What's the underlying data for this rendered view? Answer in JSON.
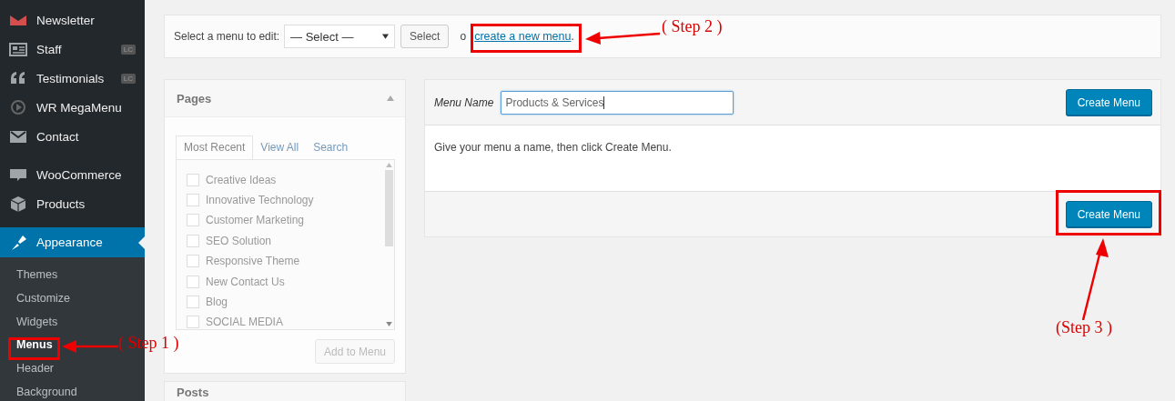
{
  "sidebar": {
    "items": [
      {
        "label": "Newsletter",
        "selected": false
      },
      {
        "label": "Staff",
        "badge": "LC",
        "selected": false
      },
      {
        "label": "Testimonials",
        "badge": "LC",
        "selected": false
      },
      {
        "label": "WR MegaMenu",
        "selected": false
      },
      {
        "label": "Contact",
        "selected": false
      },
      {
        "label": "WooCommerce",
        "selected": false
      },
      {
        "label": "Products",
        "selected": false
      },
      {
        "label": "Appearance",
        "selected": true,
        "children": [
          {
            "label": "Themes",
            "selected": false
          },
          {
            "label": "Customize",
            "selected": false
          },
          {
            "label": "Widgets",
            "selected": false
          },
          {
            "label": "Menus",
            "selected": true
          },
          {
            "label": "Header",
            "selected": false
          },
          {
            "label": "Background",
            "selected": false
          }
        ]
      }
    ]
  },
  "menu_selector": {
    "label": "Select a menu to edit:",
    "value": "— Select —",
    "button": "Select",
    "or_text": "o",
    "link": "create a new menu",
    "link_end": "."
  },
  "pages_panel": {
    "title": "Pages",
    "expanded": true,
    "tabs": [
      {
        "label": "Most Recent",
        "selected": true
      },
      {
        "label": "View All",
        "selected": false
      },
      {
        "label": "Search",
        "selected": false
      }
    ],
    "items": [
      {
        "label": "Creative Ideas",
        "checked": false
      },
      {
        "label": "Innovative Technology",
        "checked": false
      },
      {
        "label": "Customer Marketing",
        "checked": false
      },
      {
        "label": "SEO Solution",
        "checked": false
      },
      {
        "label": "Responsive Theme",
        "checked": false
      },
      {
        "label": "New Contact Us",
        "checked": false
      },
      {
        "label": "Blog",
        "checked": false
      },
      {
        "label": "SOCIAL MEDIA",
        "checked": false
      }
    ],
    "button": {
      "label": "Add to Menu",
      "disabled": true
    }
  },
  "posts_panel": {
    "title": "Posts"
  },
  "menu_panel": {
    "name_label": "Menu Name",
    "name_value": "Products & Services",
    "header_button": "Create Menu",
    "hint": "Give your menu a name, then click Create Menu.",
    "footer_button": "Create Menu"
  },
  "annotations": [
    {
      "text": "( Step 1 )"
    },
    {
      "text": "( Step 2 )"
    },
    {
      "text": "(Step 3 )"
    }
  ]
}
